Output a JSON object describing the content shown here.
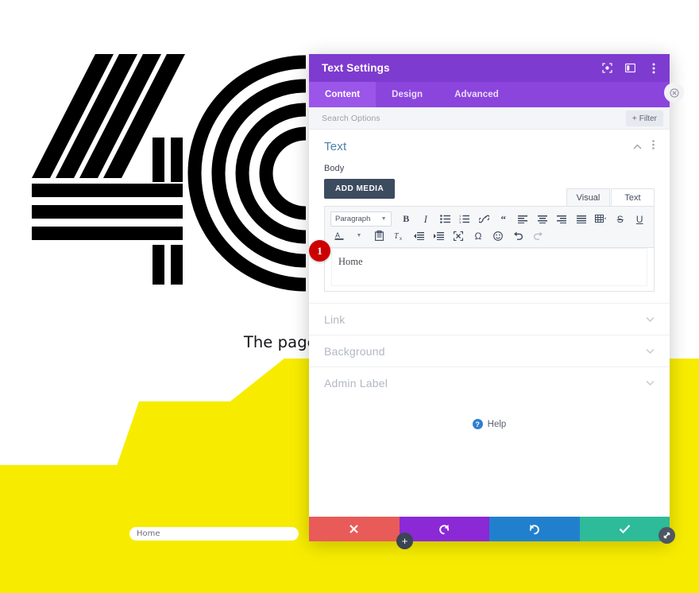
{
  "background_page": {
    "error_code": "404",
    "message": "The page you were looking",
    "home_field": {
      "value": "Home"
    },
    "colors": {
      "accent_yellow": "#f7ec00",
      "graphic_black": "#000000"
    }
  },
  "modal": {
    "title": "Text Settings",
    "header_icons": [
      {
        "name": "focus-mode-icon"
      },
      {
        "name": "split-layout-icon"
      },
      {
        "name": "more-options-icon"
      }
    ],
    "tabs": [
      {
        "label": "Content",
        "active": true
      },
      {
        "label": "Design",
        "active": false
      },
      {
        "label": "Advanced",
        "active": false
      }
    ],
    "search": {
      "placeholder": "Search Options",
      "filter_label": "Filter",
      "filter_icon": "plus-icon"
    },
    "text_group": {
      "title": "Text",
      "collapse_icon": "chevron-up-icon",
      "menu_icon": "more-options-icon",
      "body_label": "Body",
      "add_media_label": "ADD MEDIA",
      "editor_tabs": [
        {
          "label": "Visual",
          "active": true
        },
        {
          "label": "Text",
          "active": false
        }
      ],
      "toolbar_row1": [
        {
          "name": "paragraph-format-select",
          "label": "Paragraph",
          "type": "select"
        },
        {
          "name": "bold-icon",
          "label": "B"
        },
        {
          "name": "italic-icon",
          "label": "I"
        },
        {
          "name": "bullet-list-icon",
          "label": ""
        },
        {
          "name": "numbered-list-icon",
          "label": ""
        },
        {
          "name": "link-icon",
          "label": ""
        },
        {
          "name": "blockquote-icon",
          "label": ""
        },
        {
          "name": "align-left-icon",
          "label": ""
        },
        {
          "name": "align-center-icon",
          "label": ""
        },
        {
          "name": "align-right-icon",
          "label": ""
        },
        {
          "name": "align-justify-icon",
          "label": ""
        },
        {
          "name": "table-icon",
          "label": ""
        },
        {
          "name": "strikethrough-icon",
          "label": "S"
        },
        {
          "name": "underline-icon",
          "label": "U"
        }
      ],
      "toolbar_row2": [
        {
          "name": "text-color-icon",
          "label": "A"
        },
        {
          "name": "paste-as-text-icon",
          "label": ""
        },
        {
          "name": "clear-formatting-icon",
          "label": ""
        },
        {
          "name": "outdent-icon",
          "label": ""
        },
        {
          "name": "indent-icon",
          "label": ""
        },
        {
          "name": "fullscreen-icon",
          "label": ""
        },
        {
          "name": "special-character-icon",
          "label": "Ω"
        },
        {
          "name": "emoji-icon",
          "label": ""
        },
        {
          "name": "undo-icon",
          "label": ""
        },
        {
          "name": "redo-icon",
          "label": ""
        }
      ],
      "editor_content": "Home",
      "step_badge": "1"
    },
    "collapsed_groups": [
      {
        "label": "Link",
        "arrow": "chevron-down-icon"
      },
      {
        "label": "Background",
        "arrow": "chevron-down-icon"
      },
      {
        "label": "Admin Label",
        "arrow": "chevron-down-icon"
      }
    ],
    "help": {
      "label": "Help",
      "icon": "question-mark-icon"
    },
    "footer_buttons": [
      {
        "name": "discard-changes-button",
        "icon": "close-icon",
        "color": "#e85b58"
      },
      {
        "name": "undo-button",
        "icon": "undo-icon",
        "color": "#8b29d6"
      },
      {
        "name": "redo-button",
        "icon": "redo-icon",
        "color": "#2180ce"
      },
      {
        "name": "save-changes-button",
        "icon": "check-icon",
        "color": "#2dbb9a"
      }
    ]
  },
  "floating": {
    "add_module": {
      "label": "+",
      "name": "add-module-button"
    },
    "resize_handle": {
      "name": "resize-handle-icon"
    },
    "close_panel": {
      "name": "close-panel-button"
    }
  }
}
